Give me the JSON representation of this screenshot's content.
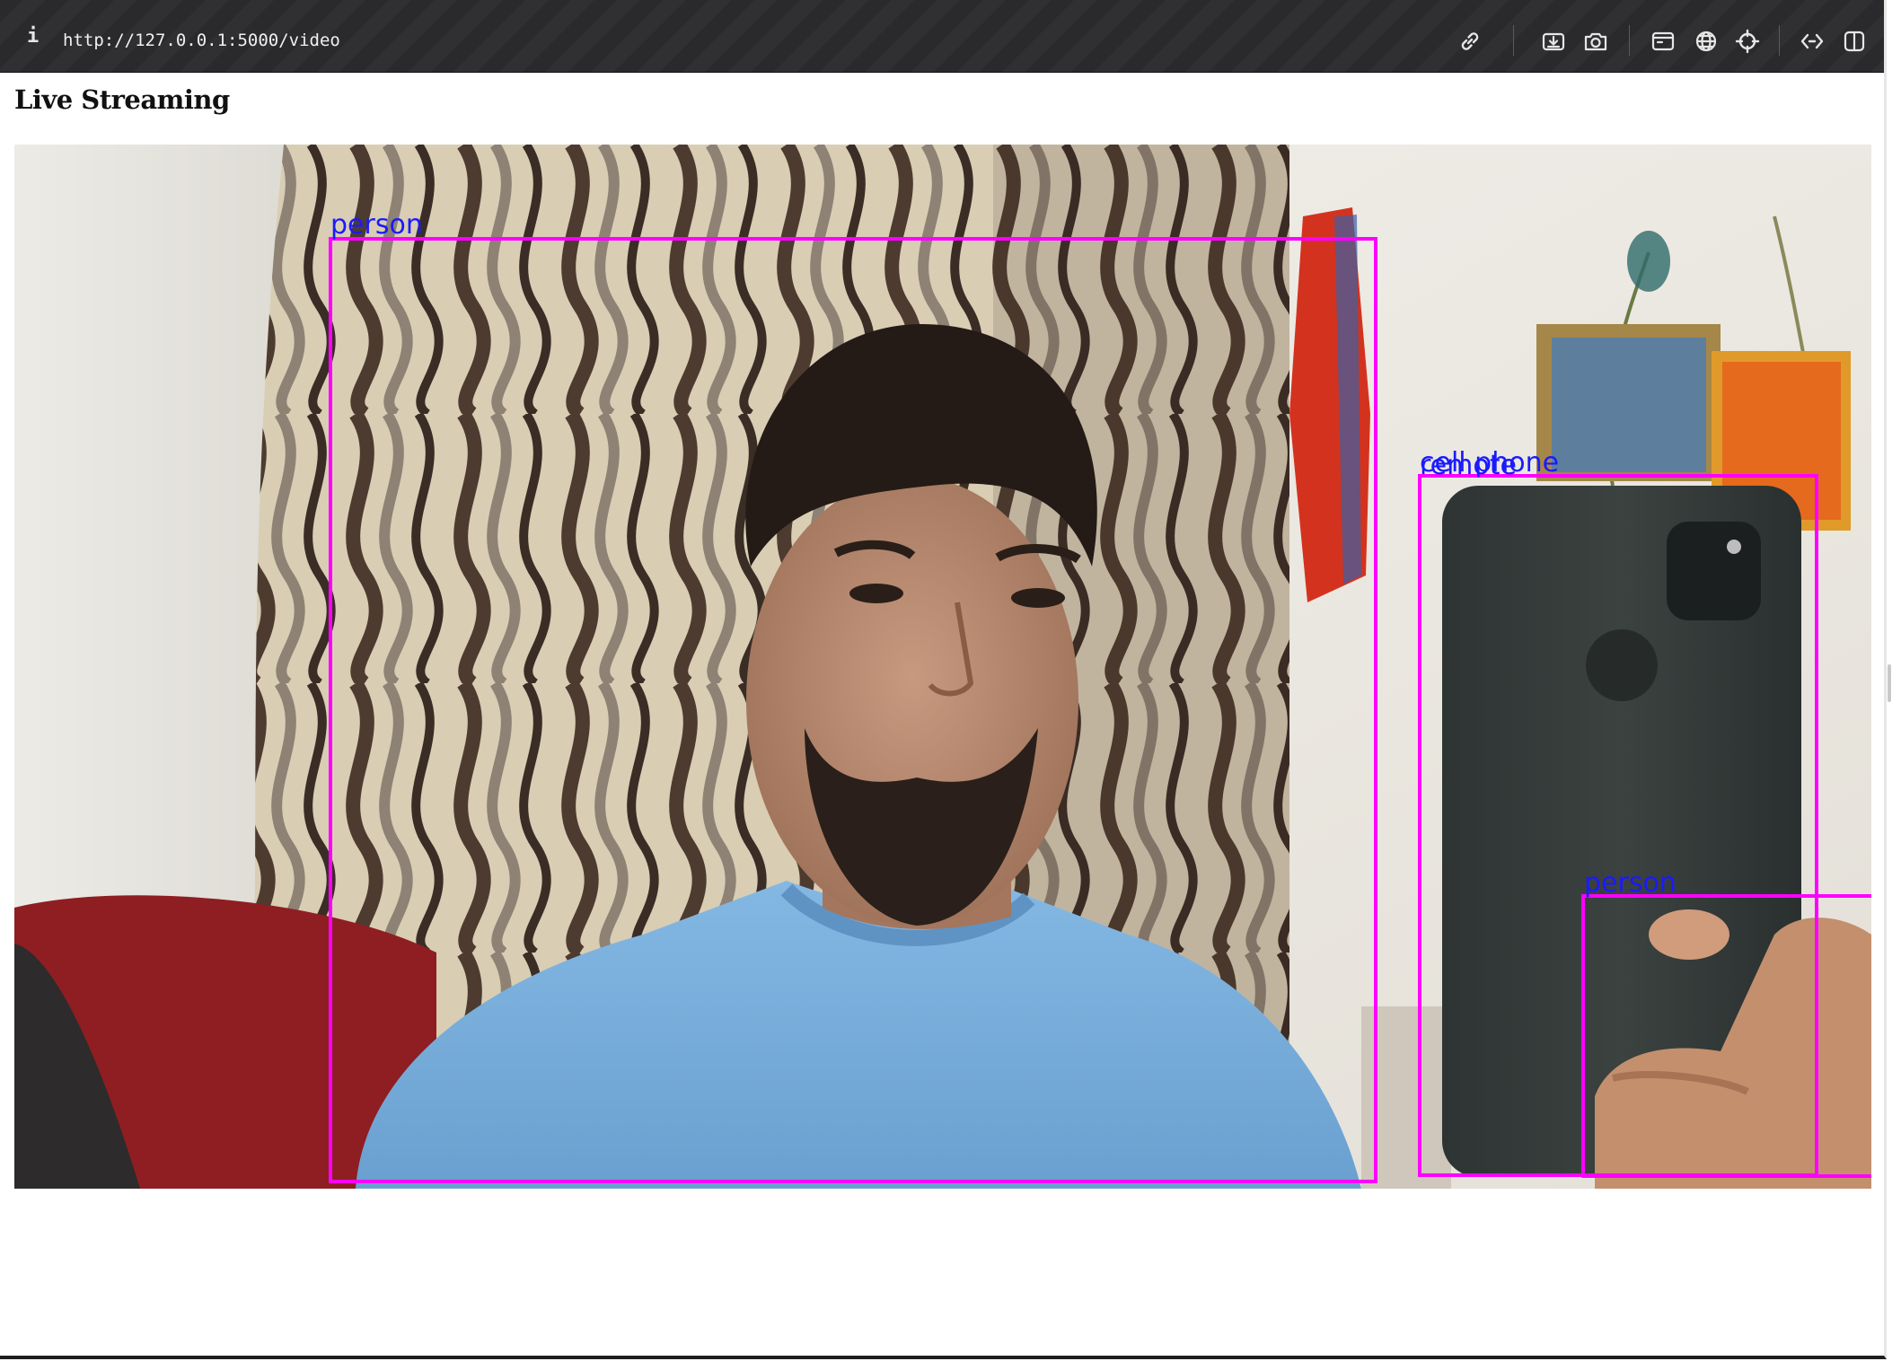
{
  "browser": {
    "address_bar": {
      "url": "http://127.0.0.1:5000/video",
      "info_icon": "info-icon"
    },
    "toolbar_icons": [
      "link-icon",
      "download-icon",
      "camera-icon",
      "terminal-icon",
      "globe-icon",
      "crosshair-icon",
      "code-icon",
      "split-view-icon"
    ]
  },
  "page": {
    "title": "Live Streaming"
  },
  "video": {
    "detections": [
      {
        "label": "person"
      },
      {
        "label": "cell phone"
      },
      {
        "label": "remote"
      },
      {
        "label": "person"
      }
    ],
    "box_color": "#ff00ff",
    "label_color": "#1a1aff"
  }
}
